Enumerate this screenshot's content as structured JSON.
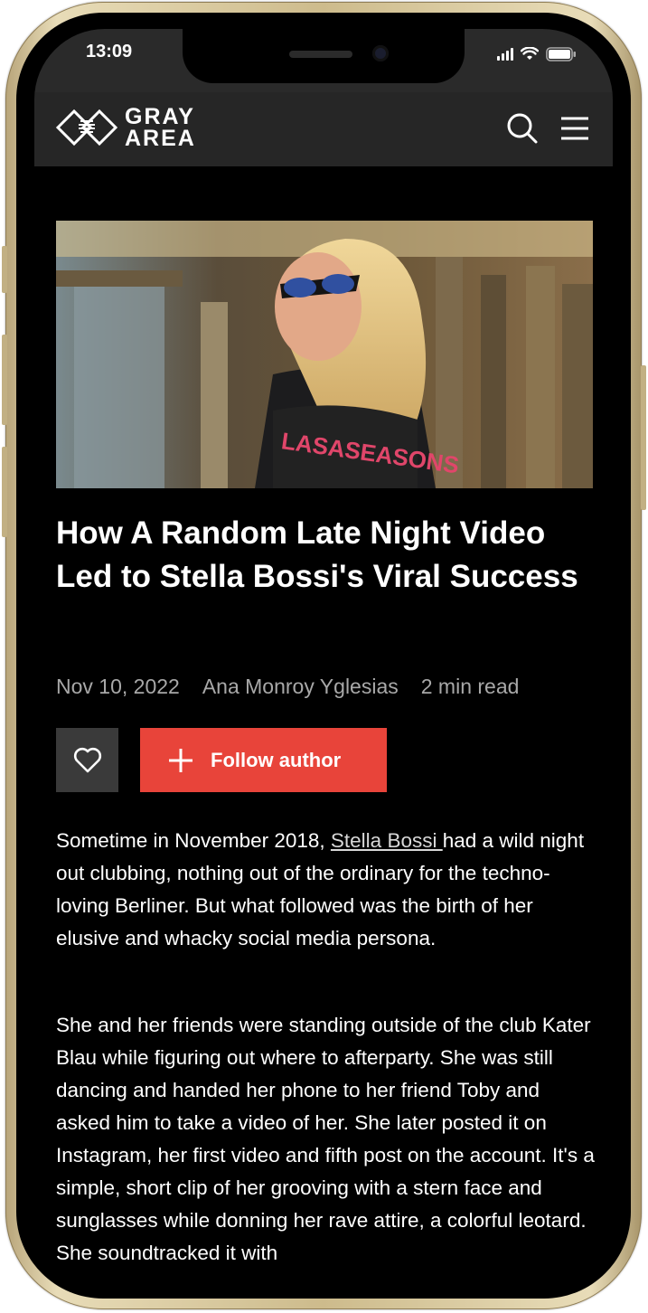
{
  "status_bar": {
    "time": "13:09"
  },
  "header": {
    "logo_line1": "GRAY",
    "logo_line2": "AREA"
  },
  "article": {
    "title": "How A Random Late Night Video Led to Stella Bossi's Viral Success",
    "date": "Nov 10, 2022",
    "author": "Ana Monroy Yglesias",
    "read_time": "2 min read",
    "follow_label": "Follow author",
    "p1_before": "Sometime in November 2018, ",
    "p1_link": "Stella Bossi ",
    "p1_after": "had a wild night out clubbing, nothing out of the ordinary for the techno-loving Berliner. But what followed was the birth of her elusive and whacky social media persona.",
    "p2": "She and her friends were standing outside of the club Kater Blau while figuring out where to afterparty. She was still dancing and handed her phone to her friend Toby and asked him to take a video of her. She later posted it on Instagram, her first video and fifth post on the account. It's a simple, short clip of her grooving with a stern face and sunglasses while donning her rave attire, a colorful leotard. She soundtracked it with"
  },
  "hero": {
    "shirt_text": "LASASEASONS"
  },
  "colors": {
    "accent": "#e8443a",
    "header_bg": "#262626",
    "like_bg": "#3a3a3a",
    "meta": "#a8a8a8"
  }
}
